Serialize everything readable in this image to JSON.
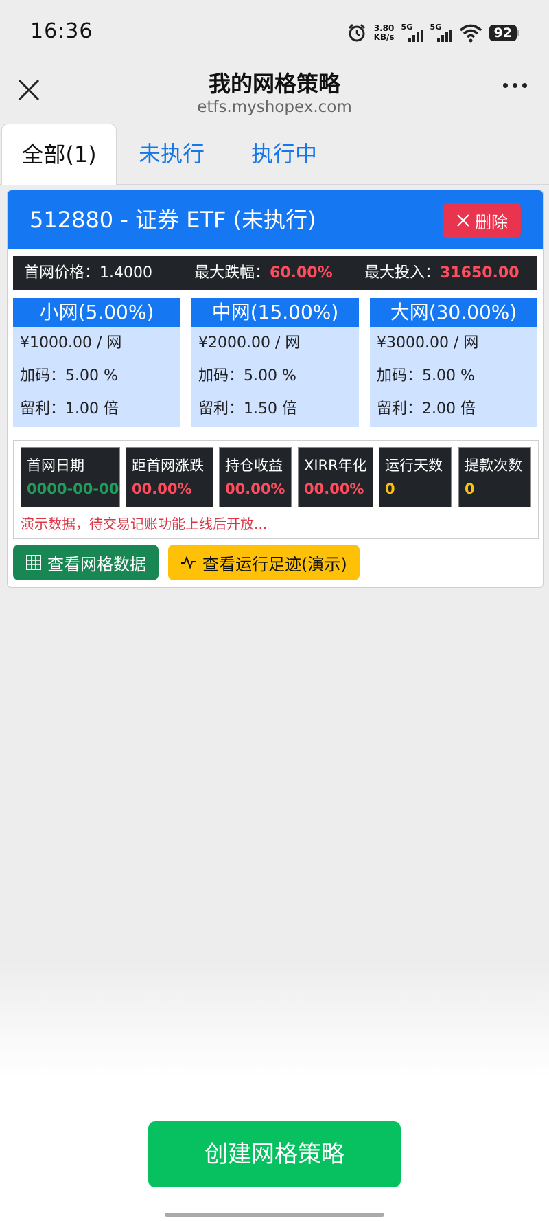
{
  "status_bar": {
    "time": "16:36",
    "net_speed_value": "3.80",
    "net_speed_unit": "KB/s",
    "sim1_label": "5G",
    "sim2_label": "5G",
    "battery": "92",
    "icons": [
      "alarm-icon",
      "signal-icon",
      "wifi-icon",
      "battery-icon"
    ]
  },
  "navbar": {
    "title": "我的网格策略",
    "subtitle": "etfs.myshopex.com",
    "icons": [
      "close-icon",
      "more-icon"
    ]
  },
  "tabs": [
    {
      "label": "全部(1)",
      "active": true
    },
    {
      "label": "未执行",
      "active": false
    },
    {
      "label": "执行中",
      "active": false
    }
  ],
  "strategy": {
    "title": "512880 - 证券 ETF (未执行)",
    "delete_label": "删除",
    "first_price_label": "首网价格：",
    "first_price_value": "1.4000",
    "max_drop_label": "最大跌幅：",
    "max_drop_value": "60.00%",
    "max_invest_label": "最大投入：",
    "max_invest_value": "31650.00",
    "grids": [
      {
        "title": "小网(5.00%)",
        "amount": "¥1000.00 / 网",
        "add": "加码：5.00 %",
        "keep": "留利：1.00 倍"
      },
      {
        "title": "中网(15.00%)",
        "amount": "¥2000.00 / 网",
        "add": "加码：5.00 %",
        "keep": "留利：1.50 倍"
      },
      {
        "title": "大网(30.00%)",
        "amount": "¥3000.00 / 网",
        "add": "加码：5.00 %",
        "keep": "留利：2.00 倍"
      }
    ],
    "stats": [
      {
        "label": "首网日期",
        "value": "0000-00-00"
      },
      {
        "label": "距首网涨跌",
        "value": "00.00%"
      },
      {
        "label": "持仓收益",
        "value": "00.00%"
      },
      {
        "label": "XIRR年化",
        "value": "00.00%"
      },
      {
        "label": "运行天数",
        "value": "0"
      },
      {
        "label": "提款次数",
        "value": "0"
      }
    ],
    "demo_note": "演示数据，待交易记账功能上线后开放...",
    "view_grid_label": "查看网格数据",
    "view_trace_label": "查看运行足迹(演示)"
  },
  "create_button_label": "创建网格策略",
  "colors": {
    "primary": "#1677f3",
    "danger": "#e8344e",
    "success": "#198754",
    "warning": "#ffc107",
    "wechat_green": "#07c160",
    "stat_green": "#1e9e5a",
    "stat_red": "#ff4d5e",
    "stat_yellow": "#ffc107"
  }
}
